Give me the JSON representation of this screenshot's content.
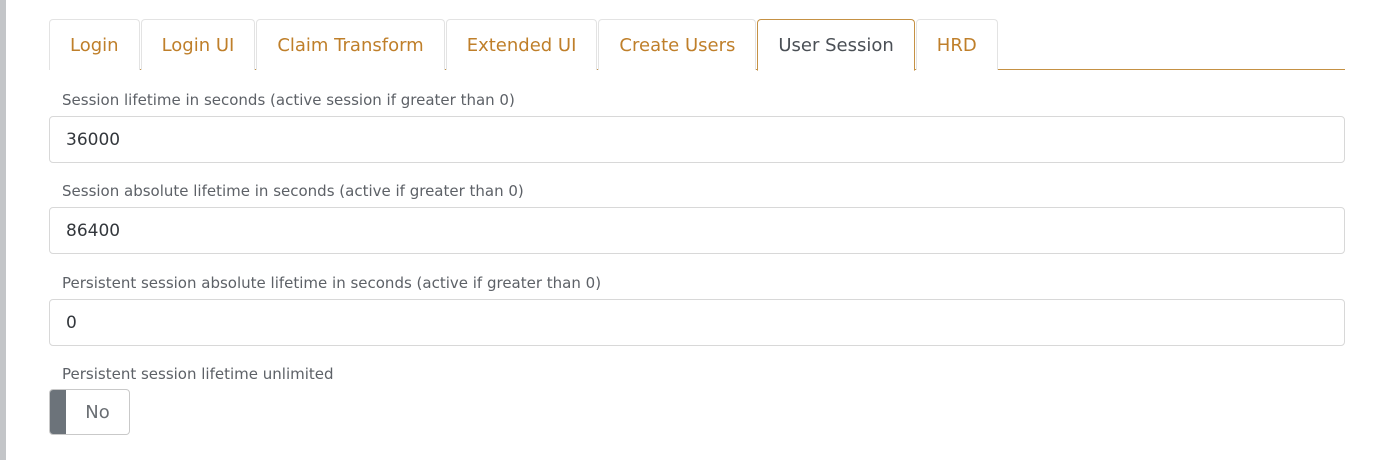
{
  "tabs": [
    {
      "label": "Login",
      "active": false
    },
    {
      "label": "Login UI",
      "active": false
    },
    {
      "label": "Claim Transform",
      "active": false
    },
    {
      "label": "Extended UI",
      "active": false
    },
    {
      "label": "Create Users",
      "active": false
    },
    {
      "label": "User Session",
      "active": true
    },
    {
      "label": "HRD",
      "active": false
    }
  ],
  "fields": {
    "session_lifetime": {
      "label": "Session lifetime in seconds (active session if greater than 0)",
      "value": "36000"
    },
    "session_absolute_lifetime": {
      "label": "Session absolute lifetime in seconds (active if greater than 0)",
      "value": "86400"
    },
    "persistent_absolute_lifetime": {
      "label": "Persistent session absolute lifetime in seconds (active if greater than 0)",
      "value": "0"
    },
    "persistent_unlimited": {
      "label": "Persistent session lifetime unlimited",
      "state": "No"
    }
  },
  "colors": {
    "accent": "#bf7f2a",
    "tab_border": "#c59144",
    "toggle_knob": "#6c737a"
  }
}
